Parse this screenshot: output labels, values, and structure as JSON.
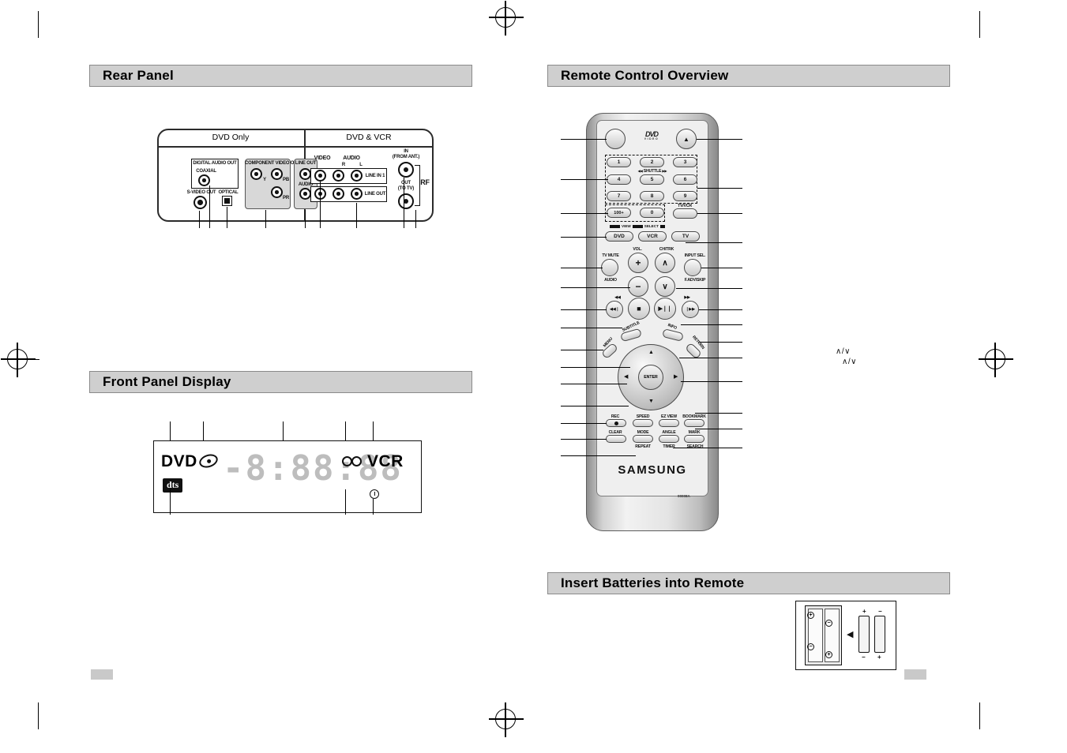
{
  "document": {
    "brand": "SAMSUNG",
    "remote_model": "00008A"
  },
  "sections": {
    "rear_panel": {
      "title": "Rear Panel"
    },
    "front_panel": {
      "title": "Front Panel Display"
    },
    "remote_overview": {
      "title": "Remote Control Overview"
    },
    "batteries": {
      "title": "Insert Batteries into Remote"
    }
  },
  "rear_panel": {
    "column_headers": [
      "DVD Only",
      "DVD & VCR"
    ],
    "labels": {
      "digital_audio_out": "DIGITAL AUDIO OUT",
      "coaxial": "COAXIAL",
      "optical": "OPTICAL",
      "s_video_out": "S-VIDEO OUT",
      "component_video_out": "COMPONENT VIDEO OUT",
      "component_y": "Y",
      "component_pb": "PB",
      "component_pr": "PR",
      "line_out": "LINE OUT",
      "audio": "AUDIO",
      "audio_l": "L",
      "audio_r": "R",
      "video": "VIDEO",
      "vcr_audio": "AUDIO",
      "vcr_audio_r": "R",
      "vcr_audio_l": "L",
      "line_in_1": "LINE IN 1",
      "vcr_line_out": "LINE OUT",
      "ant_in": "IN",
      "ant_in_sub": "(FROM ANT.)",
      "ant_out": "OUT",
      "ant_out_sub": "(TO TV)",
      "rf": "RF"
    }
  },
  "front_panel": {
    "dvd_indicator": "DVD",
    "vcr_indicator": "VCR",
    "dts_indicator": "dts",
    "segment_display": "-8:88:88",
    "icons": {
      "disc": "disc-icon",
      "reel_left": "vcr-reel-icon",
      "reel_right": "vcr-reel-icon",
      "clock": "clock-icon"
    }
  },
  "remote": {
    "logo_main": "DVD",
    "logo_sub": "VIDEO",
    "top_buttons": {
      "power": "",
      "eject": "▲"
    },
    "keypad": {
      "rows": [
        [
          "1",
          "2",
          "3"
        ],
        [
          "4",
          "5",
          "6"
        ],
        [
          "7",
          "8",
          "9"
        ]
      ],
      "hundred": "100+",
      "zero": "0",
      "tv_vcr": "TV/VCR",
      "shuttle": "SHUTTLE",
      "shuttle_left": "◀◀",
      "shuttle_right": "▶▶"
    },
    "mode_strip": {
      "view": "VIEW",
      "select": "SELECT"
    },
    "mode_buttons": [
      "DVD",
      "VCR",
      "TV"
    ],
    "volume": {
      "label": "VOL.",
      "plus": "+",
      "minus": "−"
    },
    "channel": {
      "label": "CH/TRK",
      "up": "∧",
      "down": "∨"
    },
    "tv_mute": "TV MUTE",
    "audio": "AUDIO",
    "input_sel": "INPUT SEL.",
    "f_adv_skip": "F.ADV/SKIP",
    "transport": {
      "rew_top": "◀◀",
      "ff_top": "▶▶",
      "prev": "◀◀❘",
      "stop": "■",
      "play_pause": "▶❘❘",
      "next": "❘▶▶"
    },
    "subtitle": "SUBTITLE",
    "info": "INFO",
    "menu": "MENU",
    "return": "RETURN",
    "enter": "ENTER",
    "function_rows": [
      [
        "REC",
        "SPEED",
        "EZ VIEW",
        "BOOKMARK"
      ],
      [
        "CLEAR",
        "MODE",
        "ANGLE",
        "MARK"
      ],
      [
        "REPEAT",
        "TIMER",
        "SEARCH"
      ]
    ]
  },
  "battery": {
    "polarity_plus": "+",
    "polarity_minus": "−",
    "arrow": "◀"
  },
  "stray_marks": {
    "line1": "∧/∨",
    "line2": "∧/∨"
  },
  "colors": {
    "header_bg": "#cfcfcf",
    "header_border": "#8a8a8a",
    "ink": "#000000",
    "segment_gray": "#bdbdbd",
    "page_marker": "#c9c9c9"
  }
}
